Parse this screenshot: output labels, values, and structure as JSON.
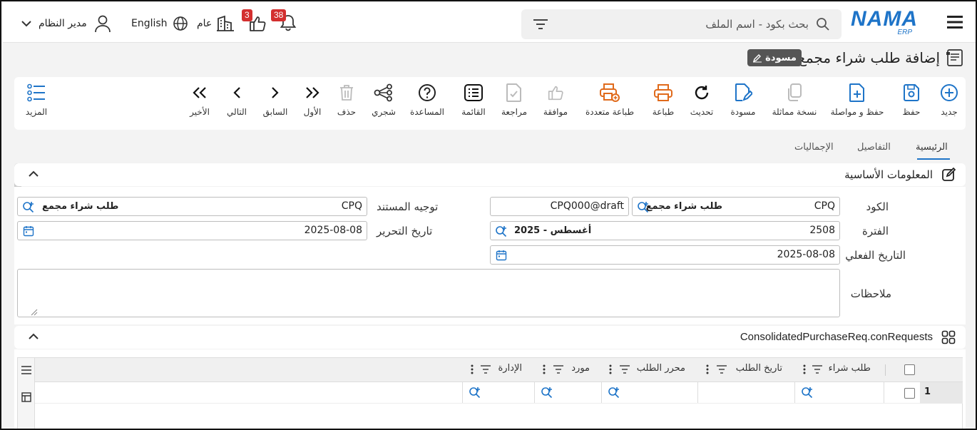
{
  "header": {
    "logo": "NAMA",
    "logo_sub": "ERP",
    "search_placeholder": "بحث بكود - اسم الملف",
    "notifications_count": "38",
    "likes_count": "3",
    "branch_label": "عام",
    "language_label": "English",
    "user_label": "مدير النظام"
  },
  "page": {
    "title": "إضافة طلب شراء مجمع",
    "status_badge": "مسودة"
  },
  "toolbar": {
    "new": "جديد",
    "save": "حفظ",
    "save_continue": "حفظ و مواصلة",
    "duplicate": "نسخة مماثلة",
    "draft": "مسودة",
    "refresh": "تحديث",
    "print": "طباعة",
    "multi_print": "طباعة متعددة",
    "approve": "موافقة",
    "review": "مراجعة",
    "list": "القائمة",
    "help": "المساعدة",
    "tree": "شجري",
    "delete": "حذف",
    "first": "الأول",
    "previous": "السابق",
    "next": "التالي",
    "last": "الأخير",
    "more": "المزيد"
  },
  "tabs": [
    "الرئيسية",
    "التفاصيل",
    "الإجماليات"
  ],
  "basic_section": {
    "title": "المعلومات الأساسية",
    "code_label": "الكود",
    "code_value": "CPQ",
    "code_name": "طلب شراء مجمع",
    "code_draft": "CPQ000@draft",
    "doc_direction_label": "توجيه المستند",
    "doc_direction_code": "CPQ",
    "doc_direction_name": "طلب شراء مجمع",
    "period_label": "الفترة",
    "period_value": "2508",
    "period_name": "أغسطس - 2025",
    "edit_date_label": "تاريخ التحرير",
    "edit_date_value": "2025-08-08",
    "actual_date_label": "التاريخ الفعلي",
    "actual_date_value": "2025-08-08",
    "notes_label": "ملاحظات"
  },
  "requests_section": {
    "title": "ConsolidatedPurchaseReq.conRequests",
    "columns": [
      "طلب شراء",
      "تاريخ الطلب",
      "محرر الطلب",
      "مورد",
      "الإدارة"
    ],
    "row_number": "1"
  }
}
